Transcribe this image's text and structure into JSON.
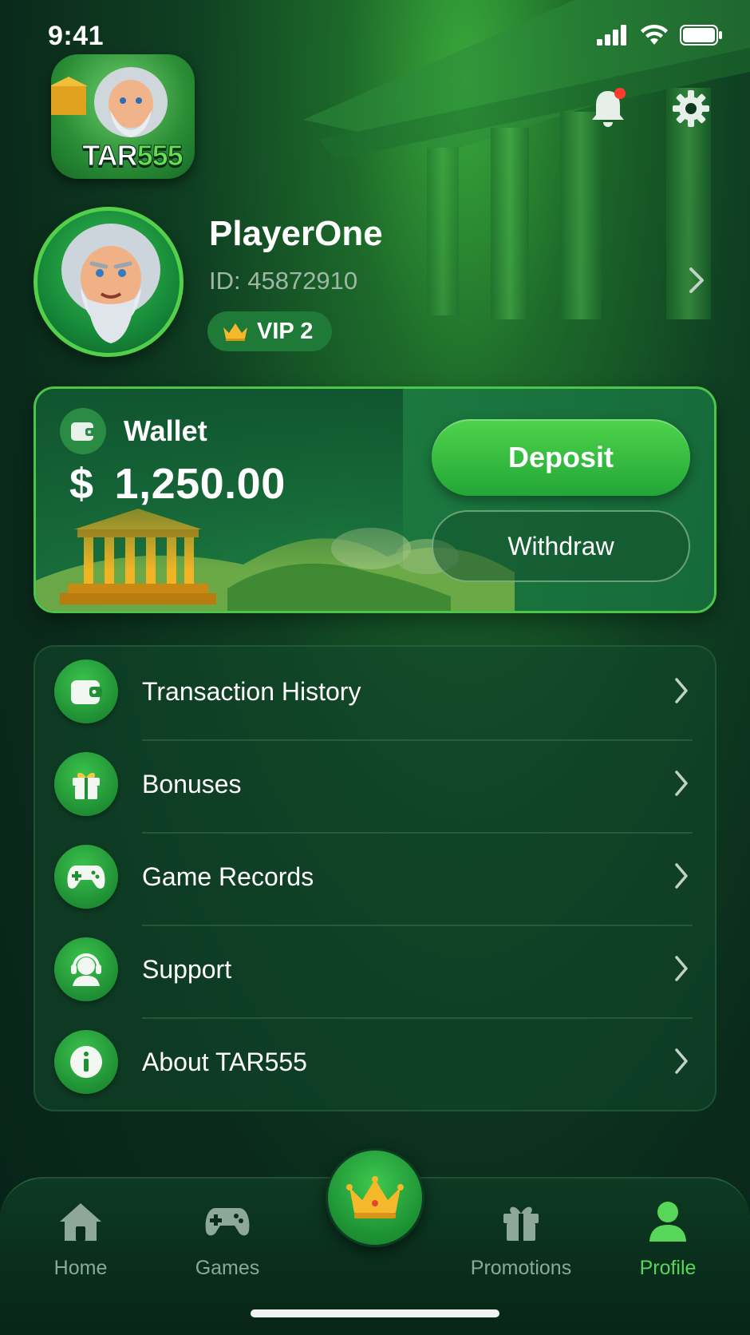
{
  "status_bar": {
    "time": "9:41"
  },
  "brand": {
    "logo_text_a": "TAR",
    "logo_text_b": "555"
  },
  "profile": {
    "username": "PlayerOne",
    "id_text": "ID: 45872910",
    "vip_label": "VIP 2"
  },
  "wallet": {
    "title": "Wallet",
    "currency_symbol": "$",
    "amount": "1,250.00",
    "deposit_label": "Deposit",
    "withdraw_label": "Withdraw"
  },
  "menu": {
    "items": [
      {
        "label": "Transaction History",
        "icon": "wallet-icon"
      },
      {
        "label": "Bonuses",
        "icon": "gift-icon"
      },
      {
        "label": "Game Records",
        "icon": "gamepad-icon"
      },
      {
        "label": "Support",
        "icon": "headset-icon"
      },
      {
        "label": "About TAR555",
        "icon": "info-icon"
      }
    ]
  },
  "bottom_nav": {
    "items": [
      {
        "label": "Home",
        "icon": "home-icon",
        "active": false
      },
      {
        "label": "Games",
        "icon": "gamepad-icon",
        "active": false
      },
      {
        "label": "",
        "icon": "crown-icon",
        "active": false
      },
      {
        "label": "Promotions",
        "icon": "gift-icon",
        "active": false
      },
      {
        "label": "Profile",
        "icon": "person-icon",
        "active": true
      }
    ]
  },
  "colors": {
    "accent": "#4ed44c",
    "active_nav": "#58d65a",
    "background": "#0a2a1b",
    "notification_dot": "#ff3b30",
    "crown": "#f5b82a"
  }
}
